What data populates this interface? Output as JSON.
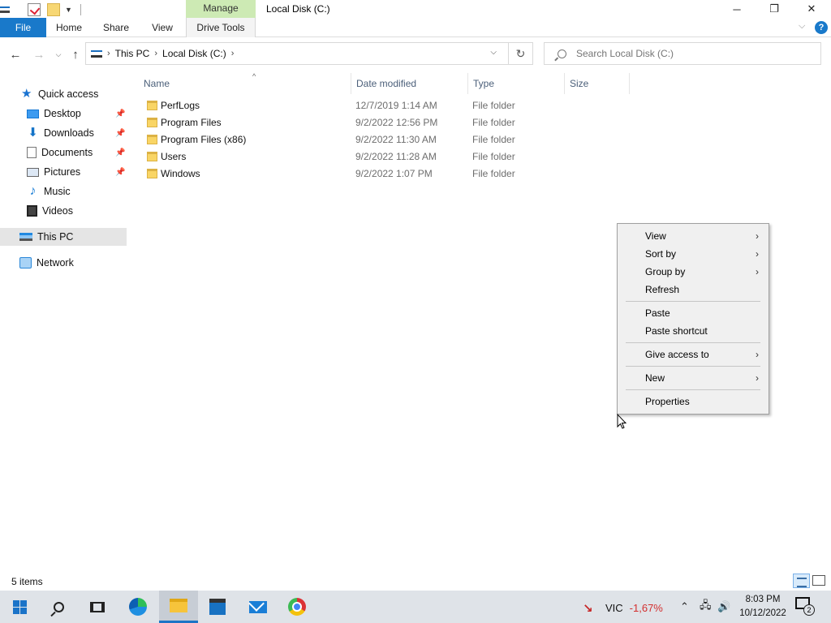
{
  "window": {
    "title": "Local Disk (C:)",
    "contextual_tab_group": "Manage",
    "controls": {
      "minimize": "─",
      "maximize": "❐",
      "close": "✕"
    }
  },
  "ribbon": {
    "tabs": [
      {
        "label": "File"
      },
      {
        "label": "Home"
      },
      {
        "label": "Share"
      },
      {
        "label": "View"
      },
      {
        "label": "Drive Tools"
      }
    ],
    "help": "?"
  },
  "address": {
    "crumbs": [
      "This PC",
      "Local Disk (C:)"
    ],
    "search_placeholder": "Search Local Disk (C:)"
  },
  "nav_pane": {
    "items": [
      {
        "label": "Quick access",
        "icon": "star-icon"
      },
      {
        "label": "Desktop",
        "icon": "desktop-icon",
        "pinned": true
      },
      {
        "label": "Downloads",
        "icon": "downloads-icon",
        "pinned": true
      },
      {
        "label": "Documents",
        "icon": "documents-icon",
        "pinned": true
      },
      {
        "label": "Pictures",
        "icon": "pictures-icon",
        "pinned": true
      },
      {
        "label": "Music",
        "icon": "music-icon"
      },
      {
        "label": "Videos",
        "icon": "videos-icon"
      },
      {
        "label": "This PC",
        "icon": "this-pc-icon",
        "selected": true
      },
      {
        "label": "Network",
        "icon": "network-icon"
      }
    ]
  },
  "file_list": {
    "columns": [
      "Name",
      "Date modified",
      "Type",
      "Size"
    ],
    "rows": [
      {
        "name": "PerfLogs",
        "date": "12/7/2019 1:14 AM",
        "type": "File folder"
      },
      {
        "name": "Program Files",
        "date": "9/2/2022 12:56 PM",
        "type": "File folder"
      },
      {
        "name": "Program Files (x86)",
        "date": "9/2/2022 11:30 AM",
        "type": "File folder"
      },
      {
        "name": "Users",
        "date": "9/2/2022 11:28 AM",
        "type": "File folder"
      },
      {
        "name": "Windows",
        "date": "9/2/2022 1:07 PM",
        "type": "File folder"
      }
    ]
  },
  "status": {
    "item_count": "5 items"
  },
  "context_menu": {
    "view": "View",
    "sort_by": "Sort by",
    "group_by": "Group by",
    "refresh": "Refresh",
    "paste": "Paste",
    "paste_shortcut": "Paste shortcut",
    "give_access_to": "Give access to",
    "new": "New",
    "properties": "Properties"
  },
  "taskbar": {
    "stock_name": "VIC",
    "stock_change": "-1,67%",
    "time": "8:03 PM",
    "date": "10/12/2022",
    "notifications": "2"
  },
  "colors": {
    "accent": "#1979ca",
    "manage_tab": "#cdeab4",
    "stock_down": "#d32f2f"
  }
}
